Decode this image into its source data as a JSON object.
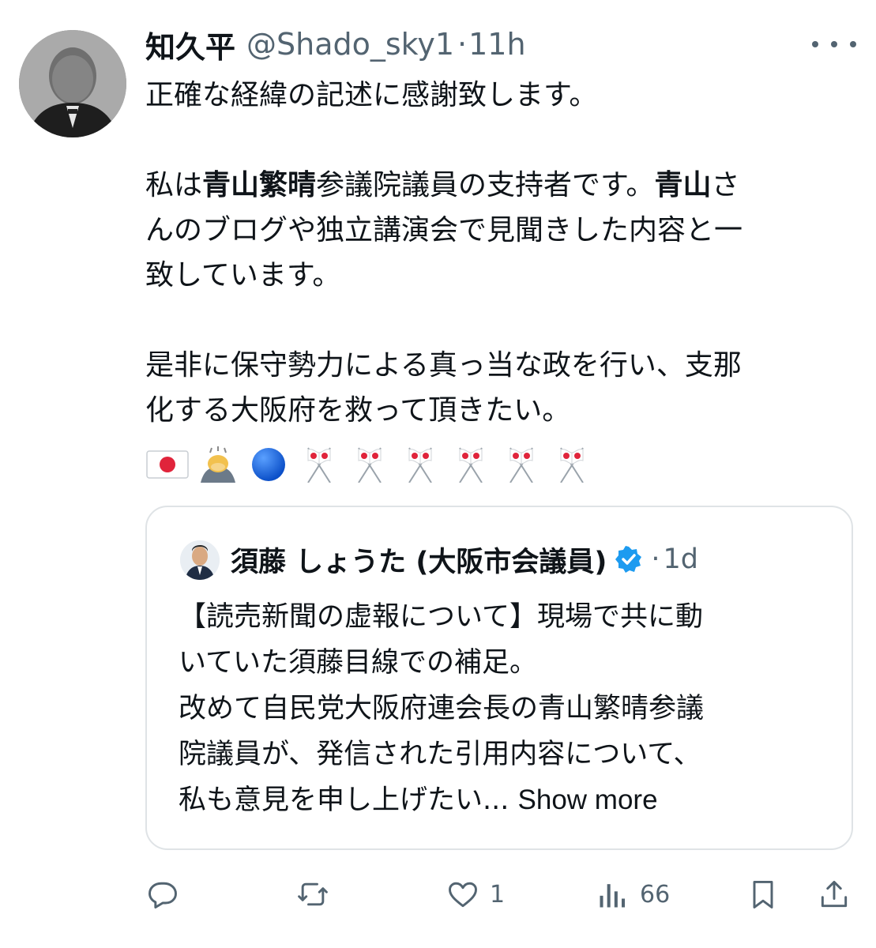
{
  "tweet": {
    "author_name": "知久平",
    "handle": "@Shado_sky1",
    "separator": "·",
    "time": "11h",
    "text": {
      "line1": "正確な経緯の記述に感謝致します。",
      "p2_pre": "私は",
      "p2_b1": "青山繁晴",
      "p2_mid": "参議院議員の支持者です。",
      "p2_b2": "青山",
      "p2_post1": "さ",
      "p2_line2": "んのブログや独立講演会で見聞きした内容と一",
      "p2_line3": "致しています。",
      "p3_line1": "是非に保守勢力による真っ当な政を行い、支那",
      "p3_line2": "化する大阪府を救って頂きたい。"
    },
    "emojis": [
      "japan-flag",
      "person-bowing",
      "blue-circle",
      "crossed-flags",
      "crossed-flags",
      "crossed-flags",
      "crossed-flags",
      "crossed-flags",
      "crossed-flags"
    ]
  },
  "quote": {
    "author_name": "須藤 しょうた (大阪市会議員)",
    "verified_color": "#1d9bf0",
    "separator": "·",
    "time": "1d",
    "lines": [
      "【読売新聞の虚報について】現場で共に動",
      "いていた須藤目線での補足。",
      "改めて自民党大阪府連会長の青山繁晴参議",
      "院議員が、発信された引用内容について、"
    ],
    "last_line": "私も意見を申し上げたい...",
    "show_more": "Show more"
  },
  "actions": {
    "reply_count": "",
    "retweet_count": "",
    "like_count": "1",
    "views_count": "66"
  },
  "colors": {
    "text": "#0f1419",
    "secondary": "#536471",
    "border": "#dfe3e6",
    "flag_red": "#e0243b"
  }
}
